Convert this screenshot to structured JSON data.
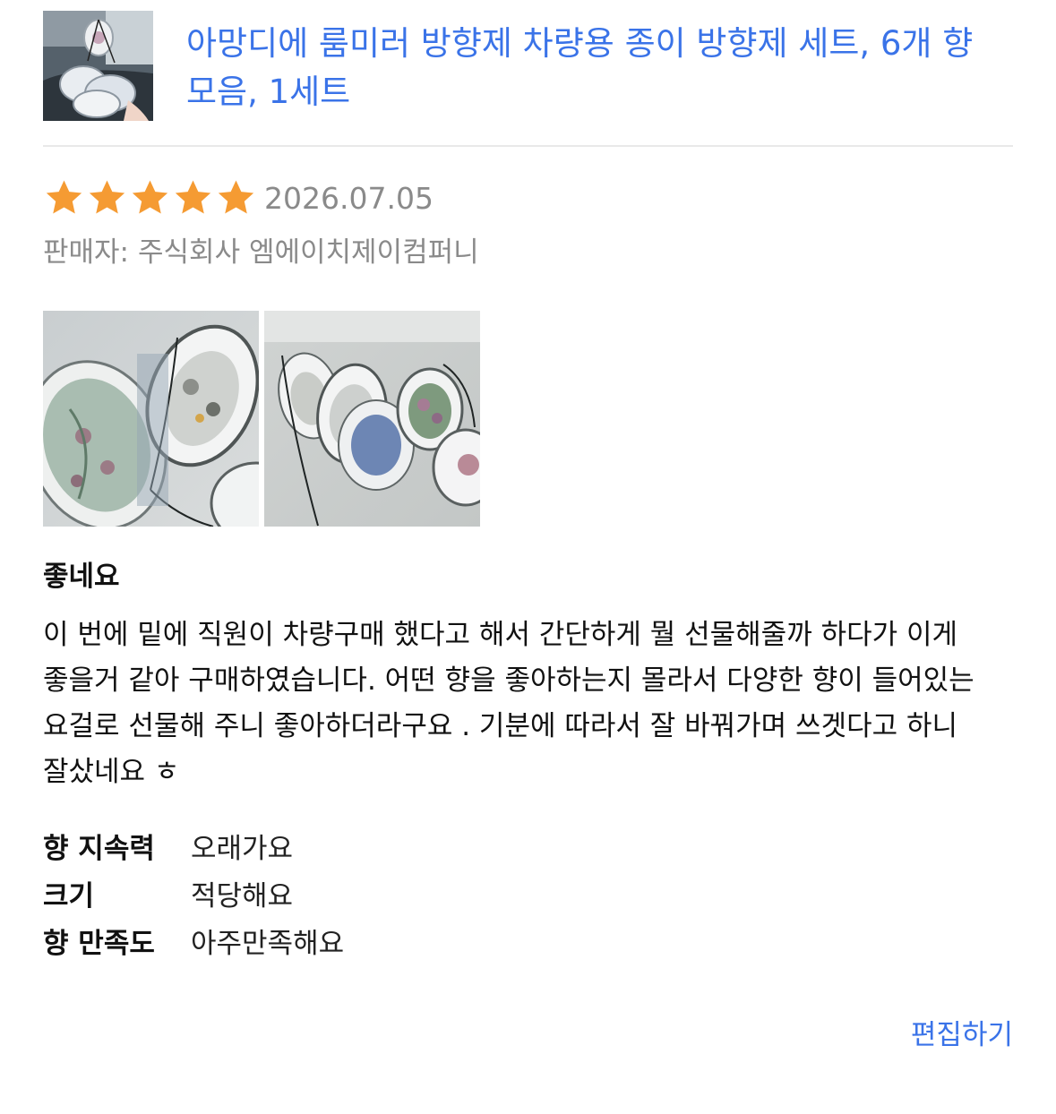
{
  "product": {
    "title": "아망디에 룸미러 방향제 차량용 종이 방향제 세트, 6개 향 모음, 1세트",
    "thumbnail_icon": "product-thumbnail"
  },
  "review": {
    "rating": 5,
    "rating_max": 5,
    "star_color": "#f59b33",
    "date": "2026.07.05",
    "seller_label": "판매자:",
    "seller_name": "주식회사 엠에이치제이컴퍼니",
    "photos": [
      {
        "icon": "review-photo-1"
      },
      {
        "icon": "review-photo-2"
      }
    ],
    "headline": "좋네요",
    "body": "이 번에 밑에 직원이 차량구매 했다고 해서 간단하게 뭘 선물해줄까 하다가 이게 좋을거 같아 구매하였습니다. 어떤 향을 좋아하는지 몰라서 다양한 향이 들어있는 요걸로 선물해 주니 좋아하더라구요 . 기분에 따라서 잘 바꿔가며 쓰겟다고 하니 잘샀네요 ㅎ",
    "attributes": [
      {
        "label": "향 지속력",
        "value": "오래가요"
      },
      {
        "label": "크기",
        "value": "적당해요"
      },
      {
        "label": "향 만족도",
        "value": "아주만족해요"
      }
    ],
    "edit_label": "편집하기"
  },
  "colors": {
    "link": "#3a73e8",
    "muted": "#8a8a8a",
    "divider": "#e9e9e9"
  }
}
